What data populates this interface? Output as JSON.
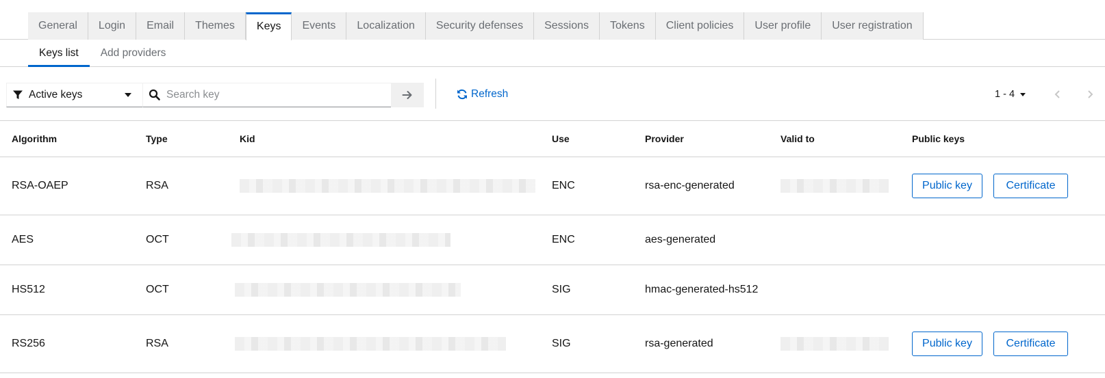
{
  "tabs": [
    {
      "label": "General"
    },
    {
      "label": "Login"
    },
    {
      "label": "Email"
    },
    {
      "label": "Themes"
    },
    {
      "label": "Keys",
      "active": true
    },
    {
      "label": "Events"
    },
    {
      "label": "Localization"
    },
    {
      "label": "Security defenses"
    },
    {
      "label": "Sessions"
    },
    {
      "label": "Tokens"
    },
    {
      "label": "Client policies"
    },
    {
      "label": "User profile"
    },
    {
      "label": "User registration"
    }
  ],
  "subtabs": [
    {
      "label": "Keys list",
      "active": true
    },
    {
      "label": "Add providers"
    }
  ],
  "toolbar": {
    "filter_label": "Active keys",
    "search_placeholder": "Search key",
    "refresh_label": "Refresh",
    "pagination_label": "1 - 4"
  },
  "table": {
    "headers": {
      "algorithm": "Algorithm",
      "type": "Type",
      "kid": "Kid",
      "use": "Use",
      "provider": "Provider",
      "valid_to": "Valid to",
      "public_keys": "Public keys"
    },
    "rows": [
      {
        "algorithm": "RSA-OAEP",
        "type": "RSA",
        "use": "ENC",
        "provider": "rsa-enc-generated",
        "public_key_label": "Public key",
        "certificate_label": "Certificate"
      },
      {
        "algorithm": "AES",
        "type": "OCT",
        "use": "ENC",
        "provider": "aes-generated"
      },
      {
        "algorithm": "HS512",
        "type": "OCT",
        "use": "SIG",
        "provider": "hmac-generated-hs512"
      },
      {
        "algorithm": "RS256",
        "type": "RSA",
        "use": "SIG",
        "provider": "rsa-generated",
        "public_key_label": "Public key",
        "certificate_label": "Certificate"
      }
    ]
  },
  "colors": {
    "accent": "#0066cc",
    "border": "#d2d2d2",
    "tab_bg": "#f0f0f0",
    "muted_text": "#6a6e73"
  }
}
